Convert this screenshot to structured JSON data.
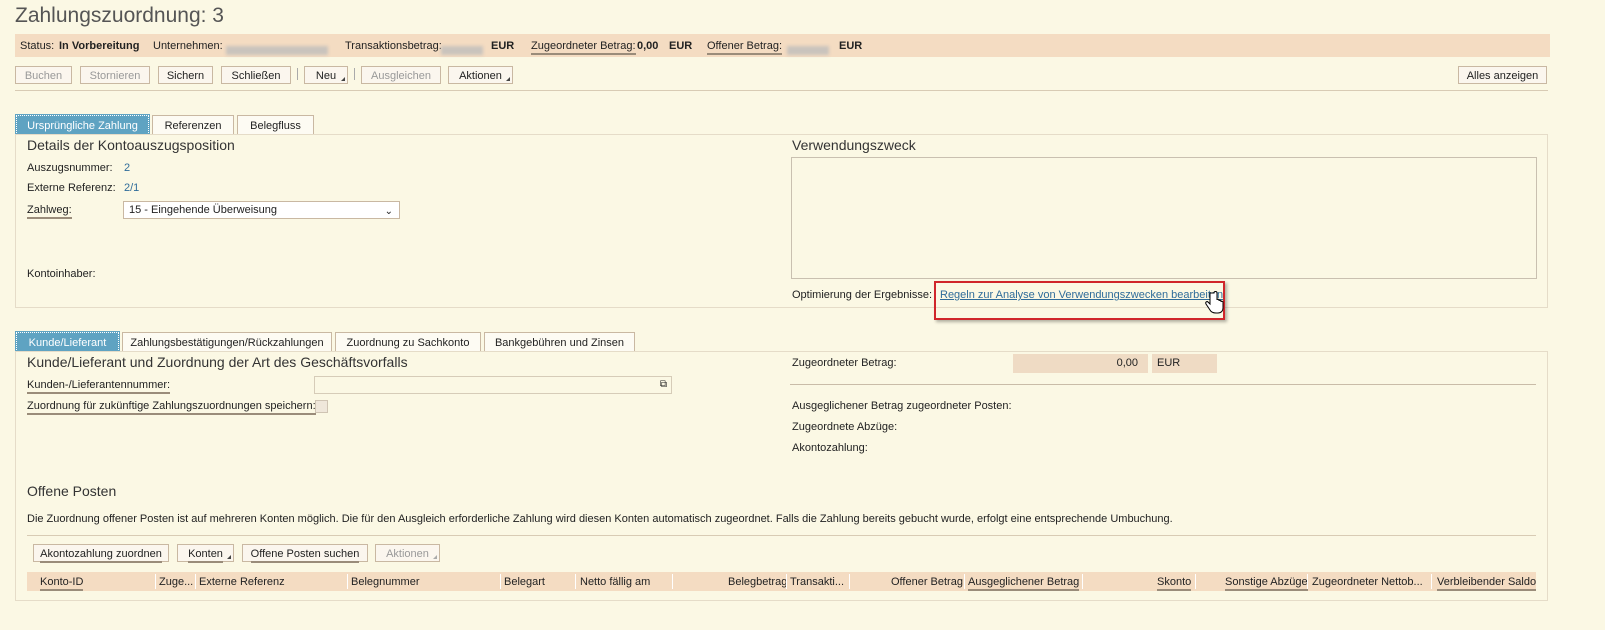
{
  "title": "Zahlungszuordnung: 3",
  "status": {
    "status_label": "Status:",
    "status_value": "In Vorbereitung",
    "company_label": "Unternehmen:",
    "transaction_label": "Transaktionsbetrag:",
    "transaction_currency": "EUR",
    "assigned_label": "Zugeordneter Betrag:",
    "assigned_value": "0,00",
    "assigned_currency": "EUR",
    "open_label": "Offener Betrag:",
    "open_currency": "EUR"
  },
  "toolbar": {
    "book": "Buchen",
    "cancel": "Stornieren",
    "save": "Sichern",
    "close": "Schließen",
    "new": "Neu",
    "clear": "Ausgleichen",
    "actions": "Aktionen",
    "show_all": "Alles anzeigen"
  },
  "tabs_top": [
    "Ursprüngliche Zahlung",
    "Referenzen",
    "Belegfluss"
  ],
  "details": {
    "heading": "Details der Kontoauszugsposition",
    "statement_no_label": "Auszugsnummer:",
    "statement_no_value": "2",
    "ext_ref_label": "Externe Referenz:",
    "ext_ref_value": "2/1",
    "payment_method_label": "Zahlweg:",
    "payment_method_value": "15 - Eingehende Überweisung",
    "account_holder_label": "Kontoinhaber:"
  },
  "purpose": {
    "heading": "Verwendungszweck",
    "optimize_label": "Optimierung der Ergebnisse:",
    "rules_link": "Regeln zur Analyse von Verwendungszwecken bearbeiten"
  },
  "tabs_bottom": [
    "Kunde/Lieferant",
    "Zahlungsbestätigungen/Rückzahlungen",
    "Zuordnung zu Sachkonto",
    "Bankgebühren und Zinsen"
  ],
  "customer": {
    "heading": "Kunde/Lieferant und Zuordnung der Art des Geschäftsvorfalls",
    "number_label": "Kunden-/Lieferantennummer:",
    "save_assignment_label": "Zuordnung für zukünftige Zahlungszuordnungen speichern:",
    "assigned_amount_label": "Zugeordneter Betrag:",
    "assigned_amount_value": "0,00",
    "assigned_amount_currency": "EUR",
    "cleared_label": "Ausgeglichener Betrag zugeordneter Posten:",
    "deductions_label": "Zugeordnete Abzüge:",
    "on_account_label": "Akontozahlung:"
  },
  "open_items": {
    "heading": "Offene Posten",
    "description": "Die Zuordnung offener Posten ist auf mehreren Konten möglich. Die für den Ausgleich erforderliche Zahlung wird diesen Konten automatisch zugeordnet. Falls die Zahlung bereits gebucht wurde, erfolgt eine entsprechende Umbuchung.",
    "btn_on_account": "Akontozahlung zuordnen",
    "btn_accounts": "Konten",
    "btn_search": "Offene Posten suchen",
    "btn_actions": "Aktionen",
    "columns": [
      "Konto-ID",
      "Zuge...",
      "Externe Referenz",
      "Belegnummer",
      "Belegart",
      "Netto fällig am",
      "Belegbetrag",
      "Transakti...",
      "Offener Betrag",
      "Ausgeglichener Betrag",
      "Skonto",
      "Sonstige Abzüge",
      "Zugeordneter Nettob...",
      "Verbleibender Saldo"
    ]
  },
  "colors": {
    "accent_tab": "#5fa3c2",
    "status_bar": "#f4dcc2",
    "highlight": "#d0262b",
    "link": "#2f6c9a"
  }
}
